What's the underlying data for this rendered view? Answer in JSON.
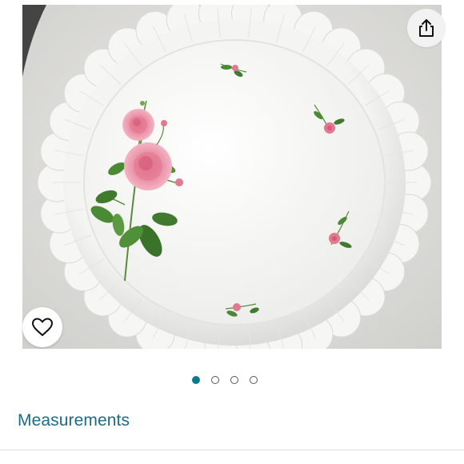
{
  "product_image": {
    "alt": "",
    "carousel": {
      "total": 4,
      "active_index": 0
    }
  },
  "icons": {
    "share": "share-icon",
    "wishlist": "heart-icon"
  },
  "colors": {
    "accent": "#0b7b8b",
    "link": "#1b6c87"
  },
  "section": {
    "measurements_label": "Measurements"
  }
}
